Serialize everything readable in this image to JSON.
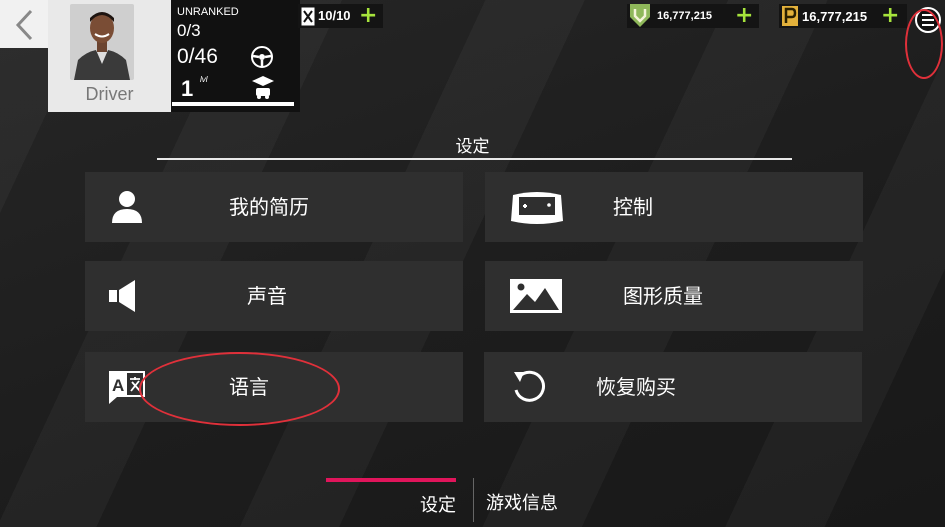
{
  "profile": {
    "name": "Driver",
    "rank_label": "UNRANKED",
    "rank_count": "0/3",
    "xp_count": "0/46",
    "level": "1",
    "level_unit": "lvl"
  },
  "resources": {
    "fuel": "10/10",
    "tokens": "16,777,215",
    "credits": "16,777,215",
    "plus": "+"
  },
  "settings": {
    "title": "设定",
    "tiles": [
      {
        "label": "我的简历",
        "icon": "person-icon"
      },
      {
        "label": "控制",
        "icon": "gamepad-icon"
      },
      {
        "label": "声音",
        "icon": "speaker-icon"
      },
      {
        "label": "图形质量",
        "icon": "image-icon"
      },
      {
        "label": "语言",
        "icon": "translate-icon"
      },
      {
        "label": "恢复购买",
        "icon": "restore-icon"
      }
    ]
  },
  "tabs": [
    {
      "label": "设定",
      "active": true
    },
    {
      "label": "游戏信息",
      "active": false
    }
  ],
  "colors": {
    "accent": "#e0155b",
    "plus": "#a6e33c",
    "annotation": "#e0303a",
    "tile": "#2f2f2f"
  }
}
